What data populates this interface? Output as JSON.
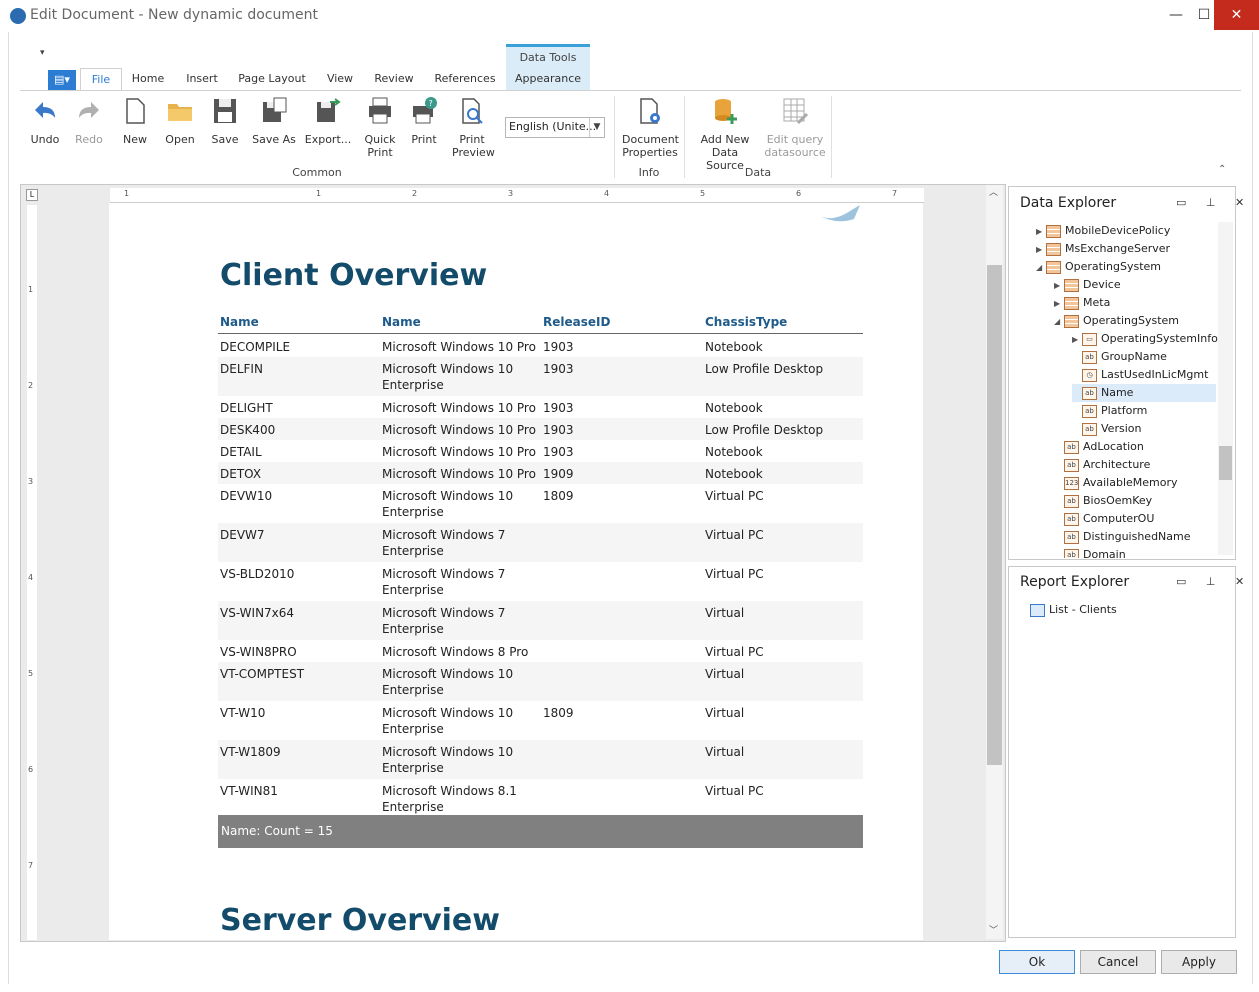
{
  "window": {
    "title": "Edit Document - New dynamic document",
    "minimize": "—",
    "maximize": "☐",
    "close": "✕"
  },
  "ribbon": {
    "qat_dropdown": "▾",
    "contextual_group": "Data Tools",
    "app_menu": "▤▾",
    "tabs": [
      "File",
      "Home",
      "Insert",
      "Page Layout",
      "View",
      "Review",
      "References",
      "Appearance"
    ],
    "common": {
      "undo": "Undo",
      "redo": "Redo",
      "new": "New",
      "open": "Open",
      "save": "Save",
      "save_as": "Save As",
      "export": "Export...",
      "quick_print_1": "Quick",
      "quick_print_2": "Print",
      "print": "Print",
      "print_preview_1": "Print",
      "print_preview_2": "Preview",
      "group_label": "Common"
    },
    "language": "English (Unite...",
    "info": {
      "doc_props_1": "Document",
      "doc_props_2": "Properties",
      "group_label": "Info"
    },
    "data": {
      "add_ds_1": "Add New",
      "add_ds_2": "Data Source",
      "edit_q_1": "Edit query",
      "edit_q_2": "datasource",
      "group_label": "Data"
    },
    "collapse": "⌃"
  },
  "ruler": {
    "corner": "L",
    "h_numbers": [
      "1",
      "1",
      "2",
      "3",
      "4",
      "5",
      "6",
      "7"
    ],
    "v_numbers": [
      "1",
      "2",
      "3",
      "4",
      "5",
      "6",
      "7"
    ]
  },
  "document": {
    "heading1": "Client Overview",
    "heading2": "Server Overview",
    "table": {
      "headers": [
        "Name",
        "Name",
        "ReleaseID",
        "ChassisType"
      ],
      "rows": [
        {
          "c1": "DECOMPILE",
          "c2": "Microsoft Windows 10 Pro",
          "c3": "1903",
          "c4": "Notebook"
        },
        {
          "c1": "DELFIN",
          "c2": "Microsoft Windows 10\nEnterprise",
          "c3": "1903",
          "c4": "Low Profile Desktop"
        },
        {
          "c1": "DELIGHT",
          "c2": "Microsoft Windows 10 Pro",
          "c3": "1903",
          "c4": "Notebook"
        },
        {
          "c1": "DESK400",
          "c2": "Microsoft Windows 10 Pro",
          "c3": "1903",
          "c4": "Low Profile Desktop"
        },
        {
          "c1": "DETAIL",
          "c2": "Microsoft Windows 10 Pro",
          "c3": "1903",
          "c4": "Notebook"
        },
        {
          "c1": "DETOX",
          "c2": "Microsoft Windows 10 Pro",
          "c3": "1909",
          "c4": "Notebook"
        },
        {
          "c1": "DEVW10",
          "c2": "Microsoft Windows 10\nEnterprise",
          "c3": "1809",
          "c4": "Virtual PC"
        },
        {
          "c1": "DEVW7",
          "c2": "Microsoft Windows 7\nEnterprise",
          "c3": "",
          "c4": "Virtual PC"
        },
        {
          "c1": "VS-BLD2010",
          "c2": "Microsoft Windows 7\nEnterprise",
          "c3": "",
          "c4": "Virtual PC"
        },
        {
          "c1": "VS-WIN7x64",
          "c2": "Microsoft Windows 7\nEnterprise",
          "c3": "",
          "c4": "Virtual"
        },
        {
          "c1": "VS-WIN8PRO",
          "c2": "Microsoft Windows 8 Pro",
          "c3": "",
          "c4": "Virtual PC"
        },
        {
          "c1": "VT-COMPTEST",
          "c2": "Microsoft Windows 10\nEnterprise",
          "c3": "",
          "c4": "Virtual"
        },
        {
          "c1": "VT-W10",
          "c2": "Microsoft Windows 10\nEnterprise",
          "c3": "1809",
          "c4": "Virtual"
        },
        {
          "c1": "VT-W1809",
          "c2": "Microsoft Windows 10\nEnterprise",
          "c3": "",
          "c4": "Virtual"
        },
        {
          "c1": "VT-WIN81",
          "c2": "Microsoft Windows 8.1\nEnterprise",
          "c3": "",
          "c4": "Virtual PC"
        }
      ],
      "footer": "Name: Count = 15"
    }
  },
  "data_explorer": {
    "title": "Data Explorer",
    "buttons": "▭ ⊥ ✕",
    "items": [
      {
        "label": "MobileDevicePolicy",
        "icon": "table",
        "expander": "▶"
      },
      {
        "label": "MsExchangeServer",
        "icon": "table",
        "expander": "▶"
      },
      {
        "label": "OperatingSystem",
        "icon": "table",
        "expander": "◢"
      },
      {
        "label": "Device",
        "icon": "table",
        "expander": "▶"
      },
      {
        "label": "Meta",
        "icon": "table",
        "expander": "▶"
      },
      {
        "label": "OperatingSystem",
        "icon": "table",
        "expander": "◢"
      },
      {
        "label": "OperatingSystemInfo",
        "icon": "object",
        "expander": "▶"
      },
      {
        "label": "GroupName",
        "icon": "ab",
        "expander": ""
      },
      {
        "label": "LastUsedInLicMgmt",
        "icon": "clock",
        "expander": ""
      },
      {
        "label": "Name",
        "icon": "ab",
        "expander": ""
      },
      {
        "label": "Platform",
        "icon": "ab",
        "expander": ""
      },
      {
        "label": "Version",
        "icon": "ab",
        "expander": ""
      },
      {
        "label": "AdLocation",
        "icon": "ab",
        "expander": ""
      },
      {
        "label": "Architecture",
        "icon": "ab",
        "expander": ""
      },
      {
        "label": "AvailableMemory",
        "icon": "123",
        "expander": ""
      },
      {
        "label": "BiosOemKey",
        "icon": "ab",
        "expander": ""
      },
      {
        "label": "ComputerOU",
        "icon": "ab",
        "expander": ""
      },
      {
        "label": "DistinguishedName",
        "icon": "ab",
        "expander": ""
      },
      {
        "label": "Domain",
        "icon": "ab",
        "expander": ""
      }
    ]
  },
  "report_explorer": {
    "title": "Report Explorer",
    "buttons": "▭ ⊥ ✕",
    "item": "List - Clients"
  },
  "footer_buttons": {
    "ok": "Ok",
    "cancel": "Cancel",
    "apply": "Apply"
  },
  "colors": {
    "accent": "#2b7cd3",
    "heading": "#134b6b",
    "table_header": "#1e5a8a",
    "footer_bar": "#808080"
  }
}
